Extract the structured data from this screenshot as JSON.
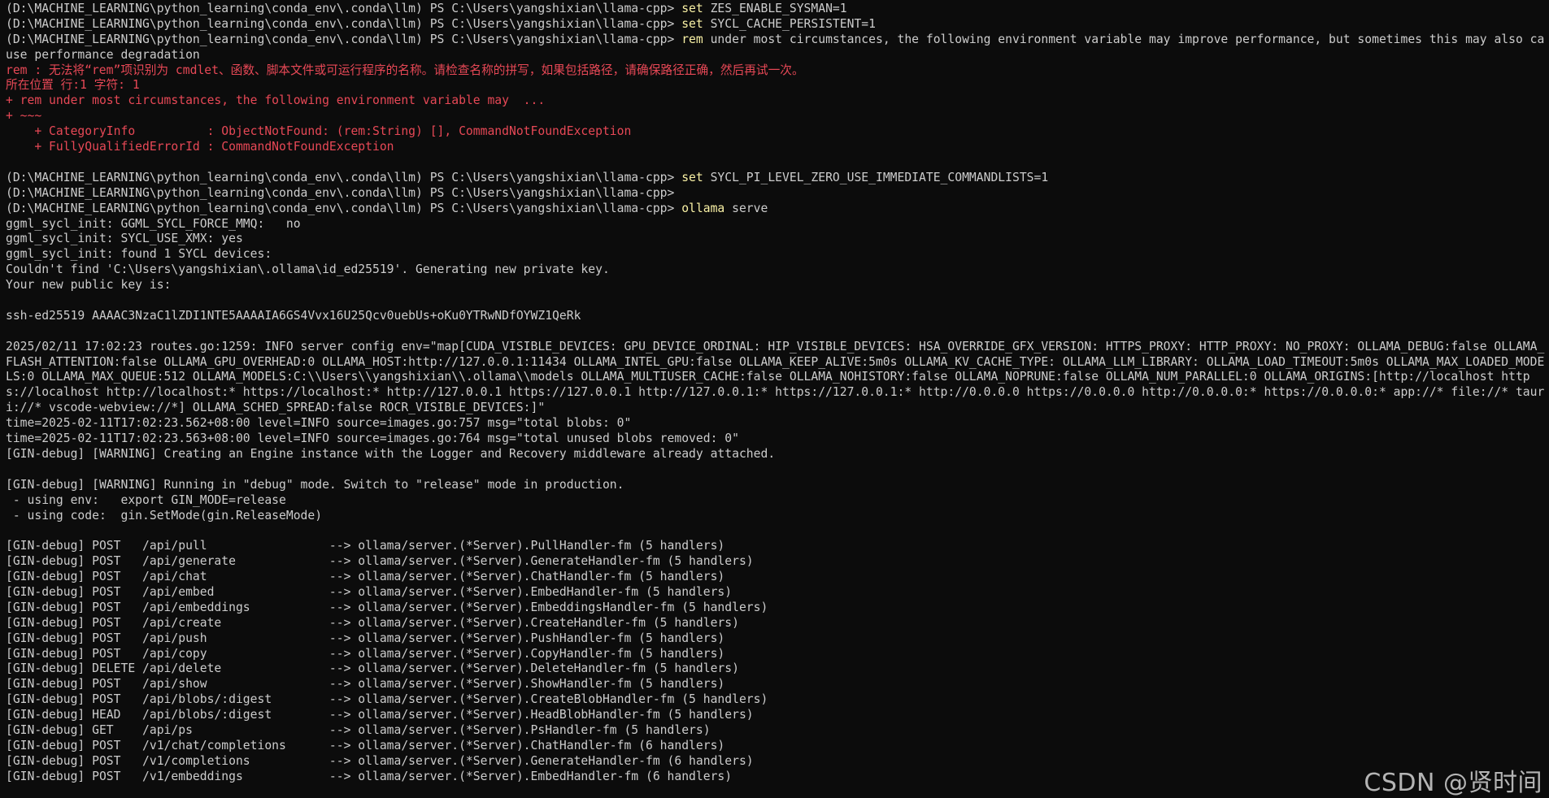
{
  "colors": {
    "background": "#0c0c0c",
    "text": "#cccccc",
    "command": "#f9f1a5",
    "error": "#e74856"
  },
  "watermark": "CSDN @贤时间",
  "lines": [
    {
      "wrap": false,
      "segments": [
        {
          "c": "default",
          "t": "(D:\\MACHINE_LEARNING\\python_learning\\conda_env\\.conda\\llm) PS C:\\Users\\yangshixian\\llama-cpp> "
        },
        {
          "c": "cmd",
          "t": "set"
        },
        {
          "c": "arg",
          "t": " ZES_ENABLE_SYSMAN=1"
        }
      ]
    },
    {
      "wrap": false,
      "segments": [
        {
          "c": "default",
          "t": "(D:\\MACHINE_LEARNING\\python_learning\\conda_env\\.conda\\llm) PS C:\\Users\\yangshixian\\llama-cpp> "
        },
        {
          "c": "cmd",
          "t": "set"
        },
        {
          "c": "arg",
          "t": " SYCL_CACHE_PERSISTENT=1"
        }
      ]
    },
    {
      "wrap": true,
      "segments": [
        {
          "c": "default",
          "t": "(D:\\MACHINE_LEARNING\\python_learning\\conda_env\\.conda\\llm) PS C:\\Users\\yangshixian\\llama-cpp> "
        },
        {
          "c": "cmd",
          "t": "rem"
        },
        {
          "c": "arg",
          "t": " under most circumstances, the following environment variable may improve performance, but sometimes this may also cause performance degradation"
        }
      ]
    },
    {
      "wrap": false,
      "segments": [
        {
          "c": "err",
          "t": "rem : 无法将“rem”项识别为 cmdlet、函数、脚本文件或可运行程序的名称。请检查名称的拼写，如果包括路径，请确保路径正确，然后再试一次。"
        }
      ]
    },
    {
      "wrap": false,
      "segments": [
        {
          "c": "err",
          "t": "所在位置 行:1 字符: 1"
        }
      ]
    },
    {
      "wrap": false,
      "segments": [
        {
          "c": "err",
          "t": "+ rem under most circumstances, the following environment variable may  ..."
        }
      ]
    },
    {
      "wrap": false,
      "segments": [
        {
          "c": "err",
          "t": "+ ~~~"
        }
      ]
    },
    {
      "wrap": false,
      "segments": [
        {
          "c": "err",
          "t": "    + CategoryInfo          : ObjectNotFound: (rem:String) [], CommandNotFoundException"
        }
      ]
    },
    {
      "wrap": false,
      "segments": [
        {
          "c": "err",
          "t": "    + FullyQualifiedErrorId : CommandNotFoundException"
        }
      ]
    },
    {
      "wrap": false,
      "segments": [
        {
          "c": "default",
          "t": ""
        }
      ]
    },
    {
      "wrap": false,
      "segments": [
        {
          "c": "default",
          "t": "(D:\\MACHINE_LEARNING\\python_learning\\conda_env\\.conda\\llm) PS C:\\Users\\yangshixian\\llama-cpp> "
        },
        {
          "c": "cmd",
          "t": "set"
        },
        {
          "c": "arg",
          "t": " SYCL_PI_LEVEL_ZERO_USE_IMMEDIATE_COMMANDLISTS=1"
        }
      ]
    },
    {
      "wrap": false,
      "segments": [
        {
          "c": "default",
          "t": "(D:\\MACHINE_LEARNING\\python_learning\\conda_env\\.conda\\llm) PS C:\\Users\\yangshixian\\llama-cpp>"
        }
      ]
    },
    {
      "wrap": false,
      "segments": [
        {
          "c": "default",
          "t": "(D:\\MACHINE_LEARNING\\python_learning\\conda_env\\.conda\\llm) PS C:\\Users\\yangshixian\\llama-cpp> "
        },
        {
          "c": "cmd",
          "t": "ollama"
        },
        {
          "c": "arg",
          "t": " serve"
        }
      ]
    },
    {
      "wrap": false,
      "segments": [
        {
          "c": "default",
          "t": "ggml_sycl_init: GGML_SYCL_FORCE_MMQ:   no"
        }
      ]
    },
    {
      "wrap": false,
      "segments": [
        {
          "c": "default",
          "t": "ggml_sycl_init: SYCL_USE_XMX: yes"
        }
      ]
    },
    {
      "wrap": false,
      "segments": [
        {
          "c": "default",
          "t": "ggml_sycl_init: found 1 SYCL devices:"
        }
      ]
    },
    {
      "wrap": false,
      "segments": [
        {
          "c": "default",
          "t": "Couldn't find 'C:\\Users\\yangshixian\\.ollama\\id_ed25519'. Generating new private key."
        }
      ]
    },
    {
      "wrap": false,
      "segments": [
        {
          "c": "default",
          "t": "Your new public key is:"
        }
      ]
    },
    {
      "wrap": false,
      "segments": [
        {
          "c": "default",
          "t": ""
        }
      ]
    },
    {
      "wrap": false,
      "segments": [
        {
          "c": "default",
          "t": "ssh-ed25519 AAAAC3NzaC1lZDI1NTE5AAAAIA6GS4Vvx16U25Qcv0uebUs+oKu0YTRwNDfOYWZ1QeRk"
        }
      ]
    },
    {
      "wrap": false,
      "segments": [
        {
          "c": "default",
          "t": ""
        }
      ]
    },
    {
      "wrap": true,
      "segments": [
        {
          "c": "default",
          "t": "2025/02/11 17:02:23 routes.go:1259: INFO server config env=\"map[CUDA_VISIBLE_DEVICES: GPU_DEVICE_ORDINAL: HIP_VISIBLE_DEVICES: HSA_OVERRIDE_GFX_VERSION: HTTPS_PROXY: HTTP_PROXY: NO_PROXY: OLLAMA_DEBUG:false OLLAMA_FLASH_ATTENTION:false OLLAMA_GPU_OVERHEAD:0 OLLAMA_HOST:http://127.0.0.1:11434 OLLAMA_INTEL_GPU:false OLLAMA_KEEP_ALIVE:5m0s OLLAMA_KV_CACHE_TYPE: OLLAMA_LLM_LIBRARY: OLLAMA_LOAD_TIMEOUT:5m0s OLLAMA_MAX_LOADED_MODELS:0 OLLAMA_MAX_QUEUE:512 OLLAMA_MODELS:C:\\\\Users\\\\yangshixian\\\\.ollama\\\\models OLLAMA_MULTIUSER_CACHE:false OLLAMA_NOHISTORY:false OLLAMA_NOPRUNE:false OLLAMA_NUM_PARALLEL:0 OLLAMA_ORIGINS:[http://localhost https://localhost http://localhost:* https://localhost:* http://127.0.0.1 https://127.0.0.1 http://127.0.0.1:* https://127.0.0.1:* http://0.0.0.0 https://0.0.0.0 http://0.0.0.0:* https://0.0.0.0:* app://* file://* tauri://* vscode-webview://*] OLLAMA_SCHED_SPREAD:false ROCR_VISIBLE_DEVICES:]\""
        }
      ]
    },
    {
      "wrap": false,
      "segments": [
        {
          "c": "default",
          "t": "time=2025-02-11T17:02:23.562+08:00 level=INFO source=images.go:757 msg=\"total blobs: 0\""
        }
      ]
    },
    {
      "wrap": false,
      "segments": [
        {
          "c": "default",
          "t": "time=2025-02-11T17:02:23.563+08:00 level=INFO source=images.go:764 msg=\"total unused blobs removed: 0\""
        }
      ]
    },
    {
      "wrap": false,
      "segments": [
        {
          "c": "default",
          "t": "[GIN-debug] [WARNING] Creating an Engine instance with the Logger and Recovery middleware already attached."
        }
      ]
    },
    {
      "wrap": false,
      "segments": [
        {
          "c": "default",
          "t": ""
        }
      ]
    },
    {
      "wrap": false,
      "segments": [
        {
          "c": "default",
          "t": "[GIN-debug] [WARNING] Running in \"debug\" mode. Switch to \"release\" mode in production."
        }
      ]
    },
    {
      "wrap": false,
      "segments": [
        {
          "c": "default",
          "t": " - using env:   export GIN_MODE=release"
        }
      ]
    },
    {
      "wrap": false,
      "segments": [
        {
          "c": "default",
          "t": " - using code:  gin.SetMode(gin.ReleaseMode)"
        }
      ]
    },
    {
      "wrap": false,
      "segments": [
        {
          "c": "default",
          "t": ""
        }
      ]
    },
    {
      "wrap": false,
      "segments": [
        {
          "c": "default",
          "t": "[GIN-debug] POST   /api/pull                 --> ollama/server.(*Server).PullHandler-fm (5 handlers)"
        }
      ]
    },
    {
      "wrap": false,
      "segments": [
        {
          "c": "default",
          "t": "[GIN-debug] POST   /api/generate             --> ollama/server.(*Server).GenerateHandler-fm (5 handlers)"
        }
      ]
    },
    {
      "wrap": false,
      "segments": [
        {
          "c": "default",
          "t": "[GIN-debug] POST   /api/chat                 --> ollama/server.(*Server).ChatHandler-fm (5 handlers)"
        }
      ]
    },
    {
      "wrap": false,
      "segments": [
        {
          "c": "default",
          "t": "[GIN-debug] POST   /api/embed                --> ollama/server.(*Server).EmbedHandler-fm (5 handlers)"
        }
      ]
    },
    {
      "wrap": false,
      "segments": [
        {
          "c": "default",
          "t": "[GIN-debug] POST   /api/embeddings           --> ollama/server.(*Server).EmbeddingsHandler-fm (5 handlers)"
        }
      ]
    },
    {
      "wrap": false,
      "segments": [
        {
          "c": "default",
          "t": "[GIN-debug] POST   /api/create               --> ollama/server.(*Server).CreateHandler-fm (5 handlers)"
        }
      ]
    },
    {
      "wrap": false,
      "segments": [
        {
          "c": "default",
          "t": "[GIN-debug] POST   /api/push                 --> ollama/server.(*Server).PushHandler-fm (5 handlers)"
        }
      ]
    },
    {
      "wrap": false,
      "segments": [
        {
          "c": "default",
          "t": "[GIN-debug] POST   /api/copy                 --> ollama/server.(*Server).CopyHandler-fm (5 handlers)"
        }
      ]
    },
    {
      "wrap": false,
      "segments": [
        {
          "c": "default",
          "t": "[GIN-debug] DELETE /api/delete               --> ollama/server.(*Server).DeleteHandler-fm (5 handlers)"
        }
      ]
    },
    {
      "wrap": false,
      "segments": [
        {
          "c": "default",
          "t": "[GIN-debug] POST   /api/show                 --> ollama/server.(*Server).ShowHandler-fm (5 handlers)"
        }
      ]
    },
    {
      "wrap": false,
      "segments": [
        {
          "c": "default",
          "t": "[GIN-debug] POST   /api/blobs/:digest        --> ollama/server.(*Server).CreateBlobHandler-fm (5 handlers)"
        }
      ]
    },
    {
      "wrap": false,
      "segments": [
        {
          "c": "default",
          "t": "[GIN-debug] HEAD   /api/blobs/:digest        --> ollama/server.(*Server).HeadBlobHandler-fm (5 handlers)"
        }
      ]
    },
    {
      "wrap": false,
      "segments": [
        {
          "c": "default",
          "t": "[GIN-debug] GET    /api/ps                   --> ollama/server.(*Server).PsHandler-fm (5 handlers)"
        }
      ]
    },
    {
      "wrap": false,
      "segments": [
        {
          "c": "default",
          "t": "[GIN-debug] POST   /v1/chat/completions      --> ollama/server.(*Server).ChatHandler-fm (6 handlers)"
        }
      ]
    },
    {
      "wrap": false,
      "segments": [
        {
          "c": "default",
          "t": "[GIN-debug] POST   /v1/completions           --> ollama/server.(*Server).GenerateHandler-fm (6 handlers)"
        }
      ]
    },
    {
      "wrap": false,
      "segments": [
        {
          "c": "default",
          "t": "[GIN-debug] POST   /v1/embeddings            --> ollama/server.(*Server).EmbedHandler-fm (6 handlers)"
        }
      ]
    }
  ]
}
